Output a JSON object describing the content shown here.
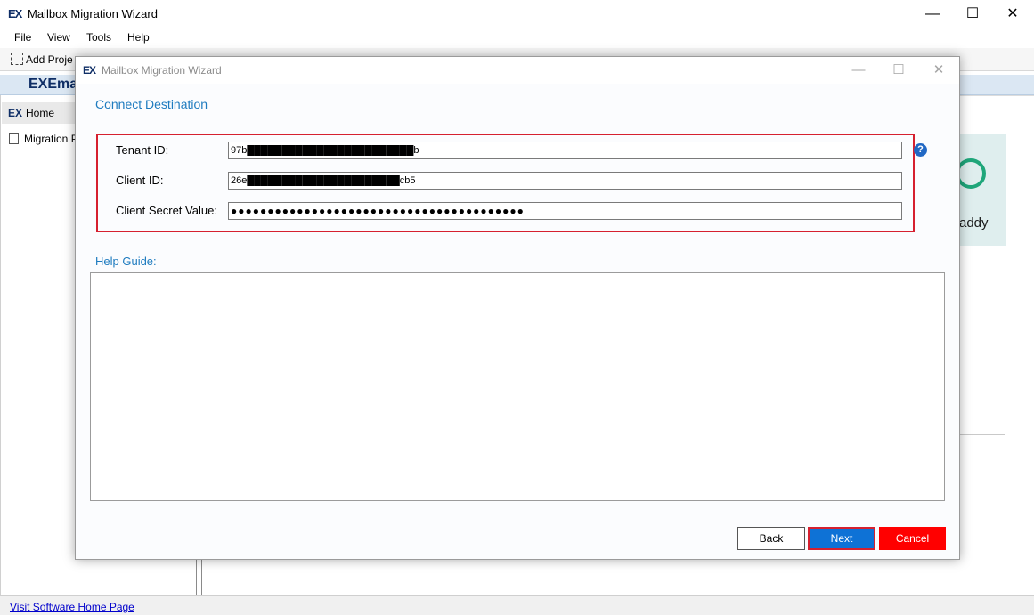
{
  "app": {
    "title": "Mailbox Migration Wizard",
    "logo": "EX",
    "brand_text": "EXEma"
  },
  "window_controls": {
    "minimize": "—",
    "maximize": "☐",
    "close": "✕"
  },
  "menu": [
    "File",
    "View",
    "Tools",
    "Help"
  ],
  "toolbar": {
    "add_project": "Add Proje"
  },
  "sidebar": {
    "home": "Home",
    "migration_project": "Migration Pr"
  },
  "background_card": {
    "text": "addy"
  },
  "statusbar": {
    "link": "Visit Software Home Page"
  },
  "dialog": {
    "title": "Mailbox Migration Wizard",
    "section_title": "Connect Destination",
    "fields": {
      "tenant_id": {
        "label": "Tenant ID:",
        "value": "97b████████████████████████b"
      },
      "client_id": {
        "label": "Client ID:",
        "value": "26e██████████████████████cb5"
      },
      "client_secret": {
        "label": "Client Secret Value:",
        "value": "●●●●●●●●●●●●●●●●●●●●●●●●●●●●●●●●●●●●●●●●"
      }
    },
    "help_icon": "?",
    "help_guide_label": "Help Guide:",
    "buttons": {
      "back": "Back",
      "next": "Next",
      "cancel": "Cancel"
    }
  },
  "colors": {
    "accent_blue": "#1e7bbf",
    "highlight_red": "#d6202f",
    "next_button": "#0e72d6",
    "cancel_button": "#ff0000"
  }
}
